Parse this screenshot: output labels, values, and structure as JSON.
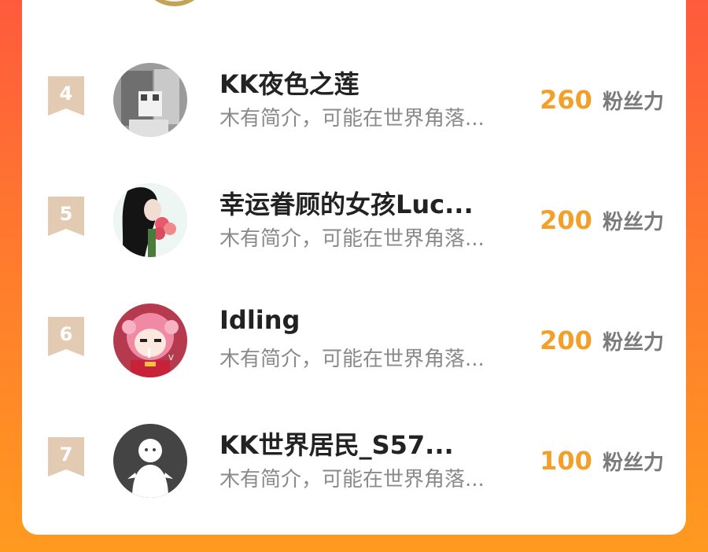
{
  "leaderboard": {
    "unit_label": "粉丝力",
    "rows": [
      {
        "rank": "4",
        "name": "KK夜色之莲",
        "bio": "木有简介，可能在世界角落...",
        "score": "260",
        "avatar_icon": "cat-photo-avatar"
      },
      {
        "rank": "5",
        "name": "幸运眷顾的女孩Luc...",
        "bio": "木有简介，可能在世界角落...",
        "score": "200",
        "avatar_icon": "girl-with-flowers-avatar"
      },
      {
        "rank": "6",
        "name": "Idling",
        "bio": "木有简介，可能在世界角落...",
        "score": "200",
        "avatar_icon": "anime-girl-avatar"
      },
      {
        "rank": "7",
        "name": "KK世界居民_S57...",
        "bio": "木有简介，可能在世界角落...",
        "score": "100",
        "avatar_icon": "default-person-avatar"
      }
    ]
  },
  "colors": {
    "background_top": "#ff5a3c",
    "background_bottom": "#ff9a1f",
    "score": "#f2a02a",
    "rank_badge": "#e3cbb3"
  }
}
